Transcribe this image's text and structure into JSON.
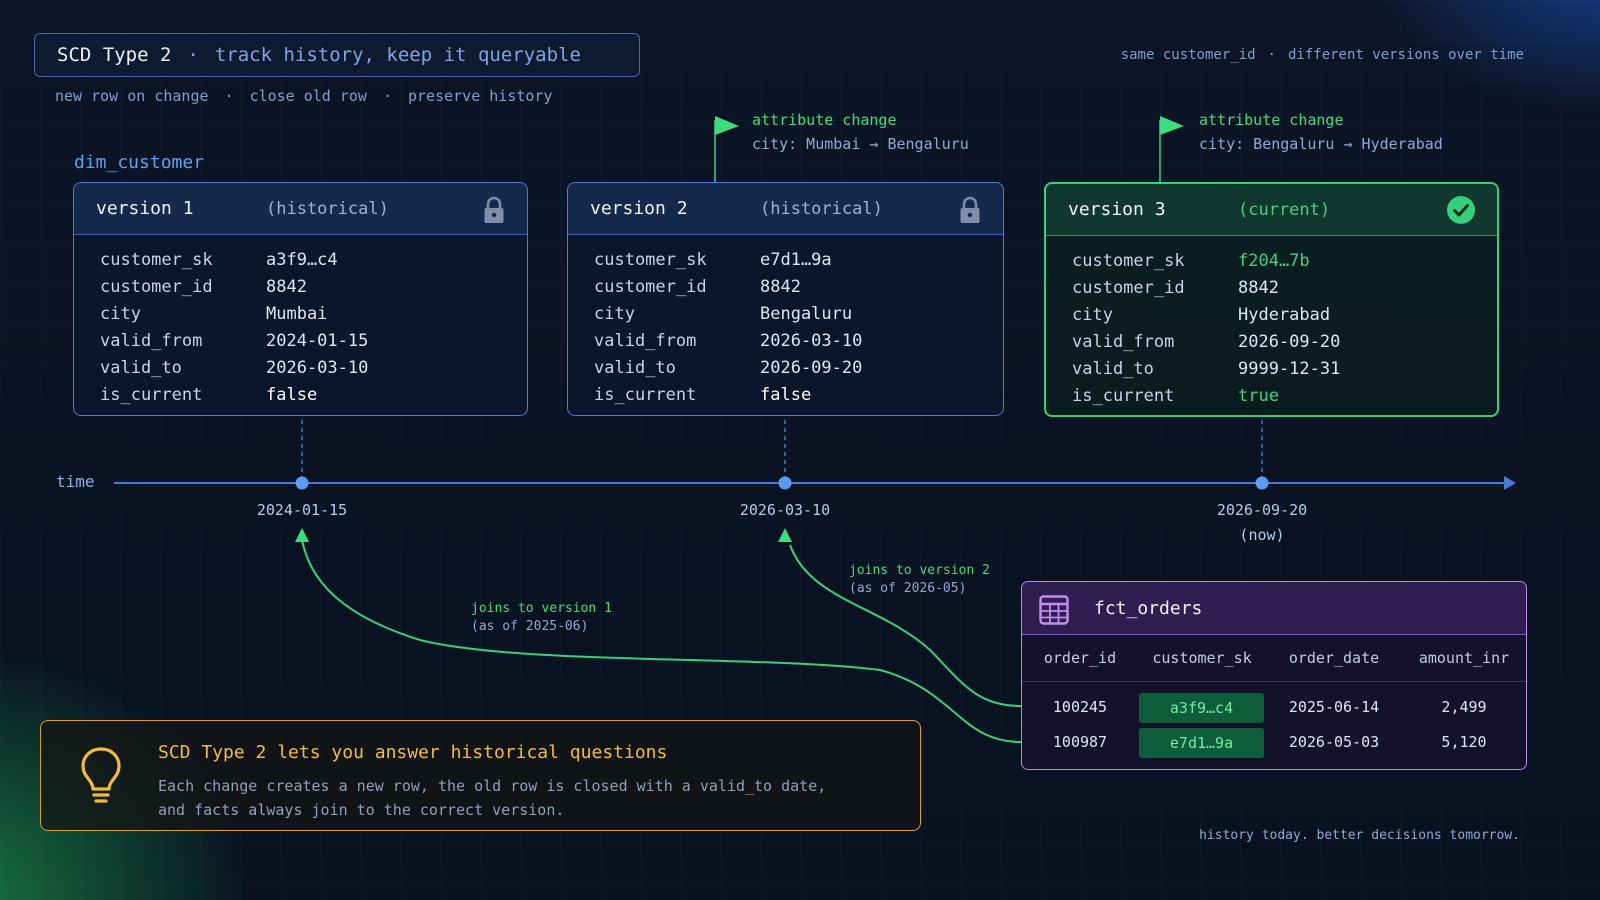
{
  "header": {
    "title": "SCD Type 2",
    "separator": "·",
    "tagline": "track history, keep it queryable",
    "subtitle": [
      "new row on change",
      "close old row",
      "preserve history"
    ],
    "subtitle_separator": "·",
    "top_right": [
      "same customer_id",
      "different versions over time"
    ],
    "top_right_separator": "·"
  },
  "dim": {
    "label": "dim_customer"
  },
  "versions": [
    {
      "name": "version 1",
      "state": "(historical)",
      "icon": "lock-icon",
      "rows": [
        {
          "key": "customer_sk",
          "value": "a3f9…c4"
        },
        {
          "key": "customer_id",
          "value": "8842"
        },
        {
          "key": "city",
          "value": "Mumbai"
        },
        {
          "key": "valid_from",
          "value": "2024-01-15"
        },
        {
          "key": "valid_to",
          "value": "2026-03-10"
        },
        {
          "key": "is_current",
          "value": "false"
        }
      ]
    },
    {
      "name": "version 2",
      "state": "(historical)",
      "icon": "lock-icon",
      "rows": [
        {
          "key": "customer_sk",
          "value": "e7d1…9a"
        },
        {
          "key": "customer_id",
          "value": "8842"
        },
        {
          "key": "city",
          "value": "Bengaluru"
        },
        {
          "key": "valid_from",
          "value": "2026-03-10"
        },
        {
          "key": "valid_to",
          "value": "2026-09-20"
        },
        {
          "key": "is_current",
          "value": "false"
        }
      ]
    },
    {
      "name": "version 3",
      "state": "(current)",
      "icon": "check-circle-icon",
      "rows": [
        {
          "key": "customer_sk",
          "value": "f204…7b"
        },
        {
          "key": "customer_id",
          "value": "8842"
        },
        {
          "key": "city",
          "value": "Hyderabad"
        },
        {
          "key": "valid_from",
          "value": "2026-09-20"
        },
        {
          "key": "valid_to",
          "value": "9999-12-31"
        },
        {
          "key": "is_current",
          "value": "true"
        }
      ]
    }
  ],
  "changes": [
    {
      "title": "attribute change",
      "detail": "city: Mumbai → Bengaluru",
      "icon": "flag-icon"
    },
    {
      "title": "attribute change",
      "detail": "city: Bengaluru → Hyderabad",
      "icon": "flag-icon"
    }
  ],
  "timeline": {
    "label": "time",
    "dates": [
      "2024-01-15",
      "2026-03-10",
      "2026-09-20"
    ],
    "now_label": "(now)"
  },
  "joins": [
    {
      "label": "joins to version 1",
      "asof": "(as of 2025-06)"
    },
    {
      "label": "joins to version 2",
      "asof": "(as of 2026-05)"
    }
  ],
  "fact": {
    "title": "fct_orders",
    "icon": "table-icon",
    "columns": [
      "order_id",
      "customer_sk",
      "order_date",
      "amount_inr"
    ],
    "rows": [
      [
        "100245",
        "a3f9…c4",
        "2025-06-14",
        "2,499"
      ],
      [
        "100987",
        "e7d1…9a",
        "2026-05-03",
        "5,120"
      ]
    ]
  },
  "callout": {
    "title": "SCD Type 2 lets you answer historical questions",
    "body": [
      "Each change creates a new row, the old row is closed with a valid_to date,",
      "and facts always join to the correct version."
    ],
    "icon": "lightbulb-icon"
  },
  "footer": "history today. better decisions tomorrow.",
  "colors": {
    "background": "#0a1425",
    "blue_accent": "#4b7bd8",
    "green_accent": "#36d07a",
    "purple_accent": "#b98ae6",
    "amber_accent": "#d3a32a"
  }
}
